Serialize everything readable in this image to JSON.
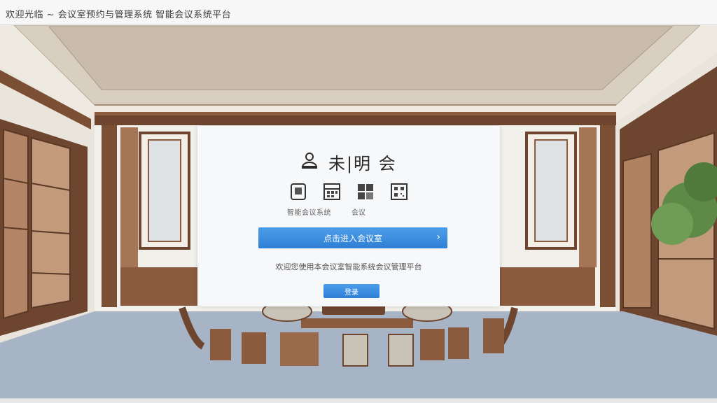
{
  "window": {
    "title": "欢迎光临 ~ 会议室预约与管理系统 智能会议系统平台"
  },
  "panel": {
    "brand_name": "未|明 会",
    "features": [
      {
        "icon": "device-icon"
      },
      {
        "icon": "calendar-icon"
      },
      {
        "icon": "grid-icon"
      },
      {
        "icon": "qr-icon"
      }
    ],
    "tagline": "智能会议系统",
    "tagline_suffix": "会议",
    "primary_button": "点击进入会议室",
    "notice": "欢迎您使用本会议室智能系统会议管理平台",
    "secondary_button": "登录"
  },
  "colors": {
    "accent": "#3a8ee0",
    "wall": "#f3f1ec",
    "wood": "#7a4f33",
    "floor": "#a6b4c8",
    "ceiling": "#d8cfc1"
  }
}
